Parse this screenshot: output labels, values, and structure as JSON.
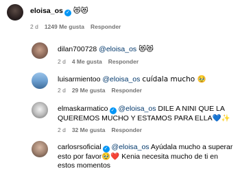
{
  "comments": [
    {
      "user": "eloisa_os",
      "verified": true,
      "mention": "",
      "text": "😻😻",
      "time": "2 d",
      "likes": "1249 Me gusta",
      "reply": "Responder"
    },
    {
      "user": "dilan700728",
      "verified": false,
      "mention": "@eloisa_os",
      "text": "😻😻",
      "time": "2 d",
      "likes": "4 Me gusta",
      "reply": "Responder"
    },
    {
      "user": "luisarmientoo",
      "verified": false,
      "mention": "@eloisa_os",
      "text": "cuídala mucho 🥹",
      "time": "2 d",
      "likes": "29 Me gusta",
      "reply": "Responder"
    },
    {
      "user": "elmaskarmatico",
      "verified": true,
      "mention": "@eloisa_os",
      "text_line1": "DILE A NINI QUE LA",
      "text_line2": "QUEREMOS MUCHO Y ESTAMOS PARA ELLA💙✨",
      "time": "2 d",
      "likes": "32 Me gusta",
      "reply": "Responder"
    },
    {
      "user": "carlosrsoficial",
      "verified": true,
      "mention": "@eloisa_os",
      "text_line1": "Ayúdala mucho a superar",
      "text_line2": "esto por favor🥹❤️ Kenia necesita mucho de ti en",
      "text_line3": "estos momentos"
    }
  ],
  "verified_glyph": "✓"
}
